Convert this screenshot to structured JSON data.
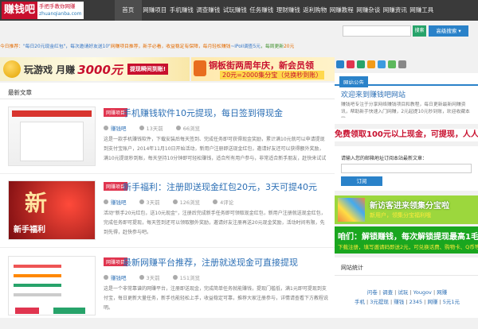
{
  "brand": {
    "name": "赚钱吧",
    "slogan": "手把手教你网赚",
    "domain": "zhuanqianba.com"
  },
  "nav": [
    "首页",
    "网赚项目",
    "手机赚钱",
    "调查赚钱",
    "试玩赚钱",
    "任务赚钱",
    "理财赚钱",
    "返利购物",
    "网赚教程",
    "网赚杂谈",
    "网赚资讯",
    "网赚工具"
  ],
  "search": {
    "placeholder": "",
    "button": "搜索",
    "advanced": "高级搜索 ▾"
  },
  "notice": {
    "prefix": "今日推荐：",
    "t1": "\"每日20元现金红包\"，每次邀请好友送10\"",
    "t2": "网赚项目推荐，新手必看，收益稳定有保障，每月轻松赚钱",
    "t3": "~iPoll调查5元",
    "t4": "，每周更新",
    "t5": "20元"
  },
  "banners": {
    "left_text": "玩游戏 月赚",
    "left_amount": "3000元",
    "left_tag": "提现瞬间到账!",
    "right_title": "铜板街两周年庆，新会员领",
    "right_sub": "20元=2000集分宝（兑换秒到账）"
  },
  "main": {
    "section_title": "最新文章",
    "posts": [
      {
        "category": "网赚项目",
        "title": "手机赚钱软件10元提现，每日签到得现金",
        "user": "赚钱吧",
        "date": "13天前",
        "views": "66浏览",
        "comments": "",
        "excerpt": "这是一款手机赚钱软件，下载安装后每天签到、完成任务即可获得现金奖励，累计满10元就可以申请提现到支付宝账户，2014年11月10日开始活动，新用户注册即送现金红包，邀请好友还可以获得额外奖励，满10元提现秒到账，每天坚持10分钟即可轻松赚钱，适合所有用户参与，非常适合新手朋友，赶快来试试吧。"
      },
      {
        "category": "网赚项目",
        "title": "新手福利：注册即送现金红包20元，3天可提40元",
        "user": "赚钱吧",
        "date": "3天前",
        "views": "126浏览",
        "comments": "4评论",
        "excerpt": "活动\"新手20元红包，送10元现金\"，注册后完成新手任务即可领取现金红包，新用户注册就送现金红包，完成任务即可提现，每天签到还可以领取额外奖励，邀请好友注册再送20元现金奖励，活动时间有限，先到先得，赶快参与吧。"
      },
      {
        "category": "网赚项目",
        "title": "最新网赚平台推荐，注册就送现金可直接提现",
        "user": "赚钱吧",
        "date": "3天前",
        "views": "151浏览",
        "comments": "",
        "excerpt": "这是一个非常靠谱的网赚平台，注册即送现金，完成简单任务就能赚钱，提现门槛低，满1元即可提现到支付宝，每日更新大量任务，新手也能轻松上手，收益稳定可靠，推荐大家注册参与，详情请查看下方教程说明。"
      }
    ]
  },
  "sidebar": {
    "head1": "网站公告",
    "notice_title": "欢迎来到赚钱吧网站",
    "notice_text": "赚钱吧专注于分享网络赚钱项目和教程，每日更新最新网赚资讯，帮助新手快速入门网赚，2元起提10元秒到账，欢迎收藏本站。",
    "ad_cash": "免费领取100元以上现金，可提现，人人有份!",
    "subscribe_label": "请输入您的邮箱地址订阅本站最新文章：",
    "subscribe_button": "订阅",
    "ad_green_title": "新访客进来领集分宝啦",
    "ad_green_sub": "新用户，领集分宝福利哦",
    "ad_unlock_title": "咱们：解锁赚钱，每次解锁提现最高1毛钱",
    "ad_unlock_sub": "下载注册，填写邀请码即送2元，可兑换话费、购物卡、Q币等",
    "stats_head": "网站统计",
    "stats_line1": [
      "问卷",
      "调查",
      "试玩",
      "Yougov",
      "网赚"
    ],
    "stats_line2": [
      "手机",
      "3元提现",
      "赚钱",
      "2345",
      "网赚",
      "5元1元"
    ]
  },
  "colors": {
    "accent": "#2a82c9",
    "brand": "#c8102e",
    "green": "#27a36a",
    "tag": "#e0354f"
  }
}
